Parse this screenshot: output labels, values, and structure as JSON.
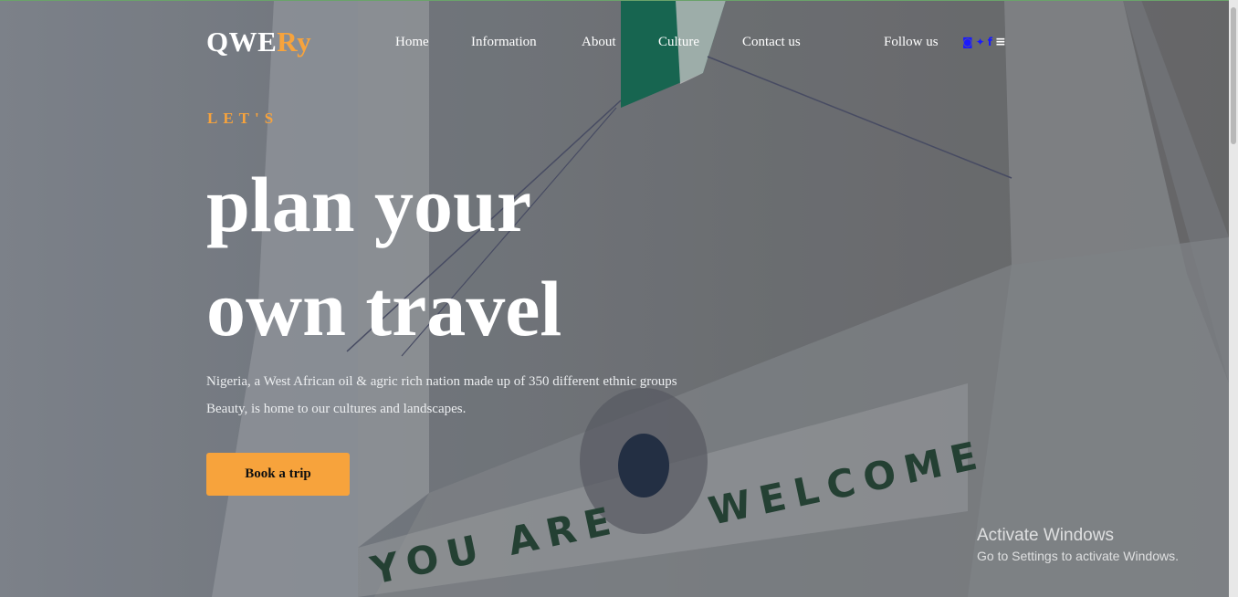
{
  "brand": {
    "prefix": "QWE",
    "suffix": "Ry"
  },
  "nav": {
    "items": [
      "Home",
      "Information",
      "About",
      "Culture",
      "Contact us"
    ]
  },
  "follow": {
    "label": "Follow us",
    "icons": [
      "instagram-icon",
      "twitter-icon",
      "facebook-icon",
      "menu-icon"
    ]
  },
  "hero": {
    "kicker": "LET'S",
    "headline_line1": "plan your",
    "headline_line2": "own travel",
    "desc_line1": "Nigeria, a West African oil & agric rich nation made up of 350 different ethnic groups",
    "desc_line2": "Beauty, is home to our cultures and landscapes.",
    "cta": "Book a trip"
  },
  "background": {
    "sign_left": "YOU ARE",
    "sign_right": "WELCOME"
  },
  "watermark": {
    "title": "Activate Windows",
    "subtitle": "Go to Settings to activate Windows."
  },
  "colors": {
    "accent": "#f7a33c",
    "social": "#1a1aff"
  }
}
